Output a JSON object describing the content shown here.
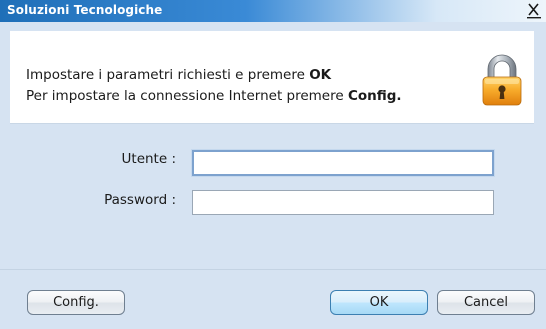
{
  "window": {
    "title": "Soluzioni Tecnologiche",
    "close_label": "X"
  },
  "header": {
    "line1_text": "Impostare i parametri richiesti e premere ",
    "line1_bold": "OK",
    "line2_text": "Per impostare la connessione Internet premere ",
    "line2_bold": "Config.",
    "icon": "padlock-icon"
  },
  "form": {
    "user_label": "Utente :",
    "user_value": "",
    "password_label": "Password :",
    "password_value": ""
  },
  "buttons": {
    "config_label": "Config.",
    "ok_label": "OK",
    "cancel_label": "Cancel"
  },
  "colors": {
    "titlebar_start": "#1f6fb8",
    "titlebar_end": "#eef5fb",
    "dialog_bg": "#d6e3f2",
    "padlock_body": "#f5a623",
    "padlock_shackle": "#9aa3ad"
  }
}
